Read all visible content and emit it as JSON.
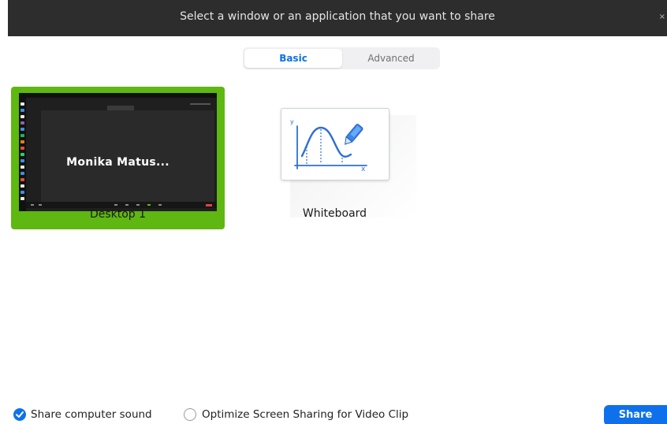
{
  "window": {
    "title": "Select a window or an application that you want to share",
    "close_glyph": "×"
  },
  "tabs": [
    {
      "label": "Basic",
      "selected": true
    },
    {
      "label": "Advanced",
      "selected": false
    }
  ],
  "share_items": [
    {
      "label": "Desktop 1",
      "thumbnail_text": "Monika Matus...",
      "selected": true,
      "icon": "desktop-thumbnail"
    },
    {
      "label": "Whiteboard",
      "selected": false,
      "icon": "whiteboard-icon"
    }
  ],
  "footer": {
    "share_sound_label": "Share computer sound",
    "share_sound_checked": true,
    "optimize_label": "Optimize Screen Sharing for Video Clip",
    "optimize_checked": false,
    "share_button_label": "Share"
  },
  "colors": {
    "accent": "#0e71eb",
    "selected_item": "#5fb711",
    "titlebar": "#2d2d2d"
  }
}
